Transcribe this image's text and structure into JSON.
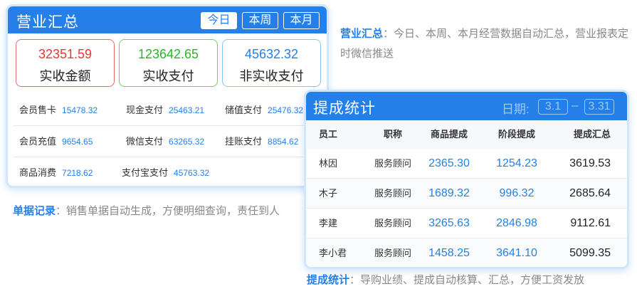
{
  "summary_card": {
    "title": "营业汇总",
    "period_tabs": [
      {
        "label": "今日",
        "active": true
      },
      {
        "label": "本周",
        "active": false
      },
      {
        "label": "本月",
        "active": false
      }
    ],
    "totals": [
      {
        "value": "32351.59",
        "label": "实收金额",
        "color": "#e53935"
      },
      {
        "value": "123642.65",
        "label": "实收支付",
        "color": "#2bb52b"
      },
      {
        "value": "45632.32",
        "label": "非实收支付",
        "color": "#2480e8"
      }
    ],
    "payments": [
      [
        {
          "label": "会员售卡",
          "value": "15478.32"
        },
        {
          "label": "现金支付",
          "value": "25463.21"
        },
        {
          "label": "储值支付",
          "value": "25476.32"
        }
      ],
      [
        {
          "label": "会员充值",
          "value": "9654.65"
        },
        {
          "label": "微信支付",
          "value": "63265.32"
        },
        {
          "label": "挂账支付",
          "value": "8854.62"
        }
      ],
      [
        {
          "label": "商品消费",
          "value": "7218.62"
        },
        {
          "label": "支付宝支付",
          "value": "45763.32"
        }
      ]
    ]
  },
  "captions": {
    "summary": {
      "highlight": "营业汇总",
      "text": "：今日、本周、本月经营数据自动汇总，营业报表定时微信推送"
    },
    "receipts": {
      "highlight": "单据记录",
      "text": "：销售单据自动生成，方便明细查询，责任到人"
    },
    "commission": {
      "highlight": "提成统计",
      "text": "：导购业绩、提成自动核算、汇总，方便工资发放"
    }
  },
  "commission_card": {
    "title": "提成统计",
    "date_label": "日期:",
    "date_from": "3.1",
    "date_sep": "–",
    "date_to": "3.31",
    "columns": [
      "员工",
      "职称",
      "商品提成",
      "阶段提成",
      "提成汇总"
    ],
    "rows": [
      {
        "name": "林因",
        "role": "服务顾问",
        "product": "2365.30",
        "stage": "1254.23",
        "total": "3619.53"
      },
      {
        "name": "木子",
        "role": "服务顾问",
        "product": "1689.32",
        "stage": "996.32",
        "total": "2685.64"
      },
      {
        "name": "李建",
        "role": "服务顾问",
        "product": "3265.63",
        "stage": "2846.98",
        "total": "9112.61"
      },
      {
        "name": "李小君",
        "role": "服务顾问",
        "product": "1458.25",
        "stage": "3641.10",
        "total": "5099.35"
      }
    ]
  }
}
